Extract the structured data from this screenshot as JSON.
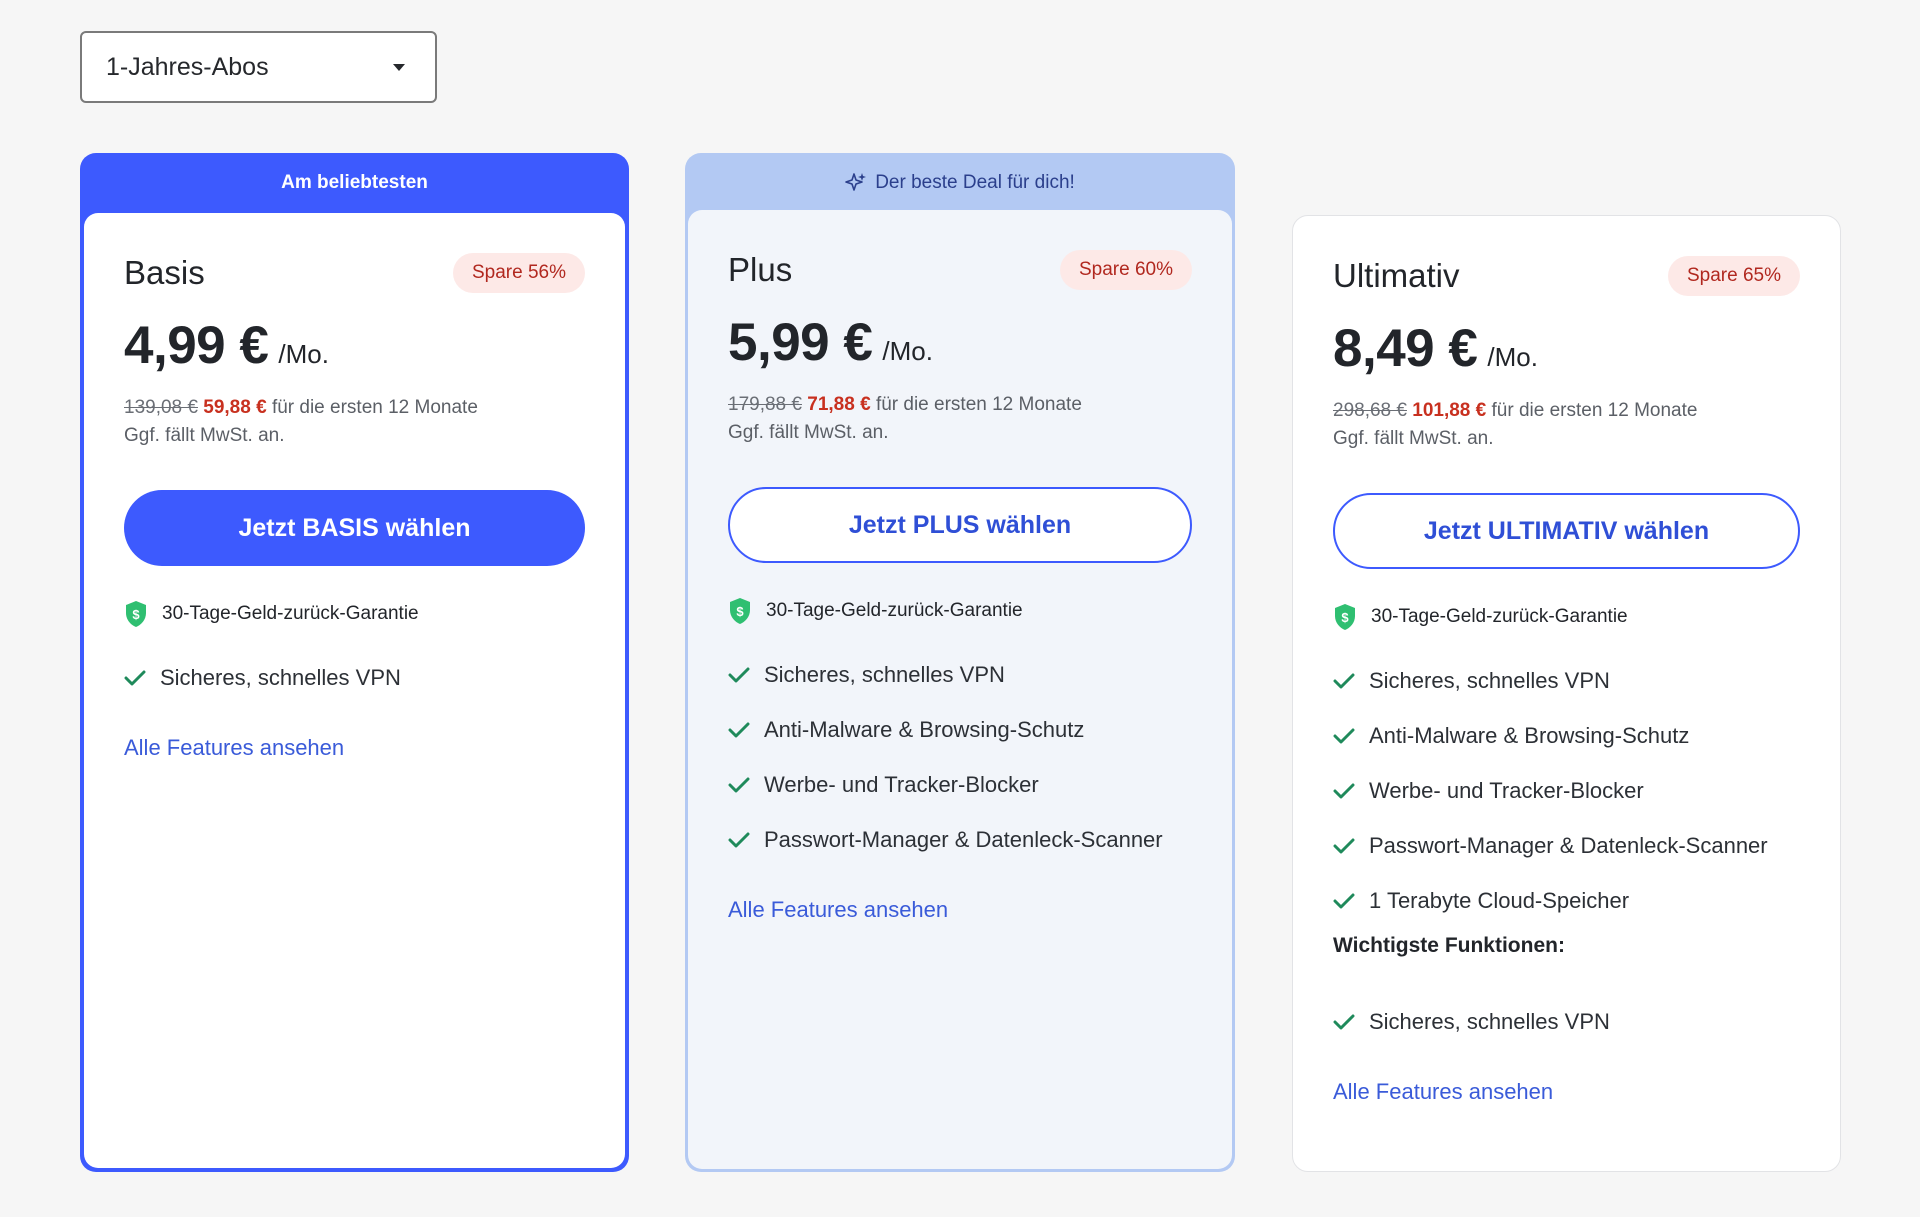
{
  "period_select": {
    "value": "1-Jahres-Abos"
  },
  "plans": [
    {
      "banner": "Am beliebtesten",
      "name": "Basis",
      "save": "Spare 56%",
      "price": "4,99 €",
      "per": "/Mo.",
      "old_total": "139,08 €",
      "new_total": "59,88 €",
      "term": "für die ersten 12 Monate",
      "vat": "Ggf. fällt MwSt. an.",
      "cta": "Jetzt BASIS wählen",
      "guarantee": "30-Tage-Geld-zurück-Garantie",
      "features": [
        "Sicheres, schnelles VPN"
      ],
      "link": "Alle Features ansehen"
    },
    {
      "banner": "Der beste Deal für dich!",
      "name": "Plus",
      "save": "Spare 60%",
      "price": "5,99 €",
      "per": "/Mo.",
      "old_total": "179,88 €",
      "new_total": "71,88 €",
      "term": "für die ersten 12 Monate",
      "vat": "Ggf. fällt MwSt. an.",
      "cta": "Jetzt PLUS wählen",
      "guarantee": "30-Tage-Geld-zurück-Garantie",
      "features": [
        "Sicheres, schnelles VPN",
        "Anti-Malware & Browsing-Schutz",
        "Werbe- und Tracker-Blocker",
        "Passwort-Manager & Datenleck-Scanner"
      ],
      "link": "Alle Features ansehen"
    },
    {
      "name": "Ultimativ",
      "save": "Spare 65%",
      "price": "8,49 €",
      "per": "/Mo.",
      "old_total": "298,68 €",
      "new_total": "101,88 €",
      "term": "für die ersten 12 Monate",
      "vat": "Ggf. fällt MwSt. an.",
      "cta": "Jetzt ULTIMATIV wählen",
      "guarantee": "30-Tage-Geld-zurück-Garantie",
      "features": [
        "Sicheres, schnelles VPN",
        "Anti-Malware & Browsing-Schutz",
        "Werbe- und Tracker-Blocker",
        "Passwort-Manager & Datenleck-Scanner",
        "1 Terabyte Cloud-Speicher"
      ],
      "subhead": "Wichtigste Funktionen:",
      "key_features": [
        "Sicheres, schnelles VPN"
      ],
      "link": "Alle Features ansehen"
    }
  ],
  "colors": {
    "accent": "#3d5afe",
    "check": "#1f8a5b",
    "shield": "#2fbf71",
    "save_badge_bg": "#fde9e7",
    "save_badge_text": "#b1281f"
  }
}
